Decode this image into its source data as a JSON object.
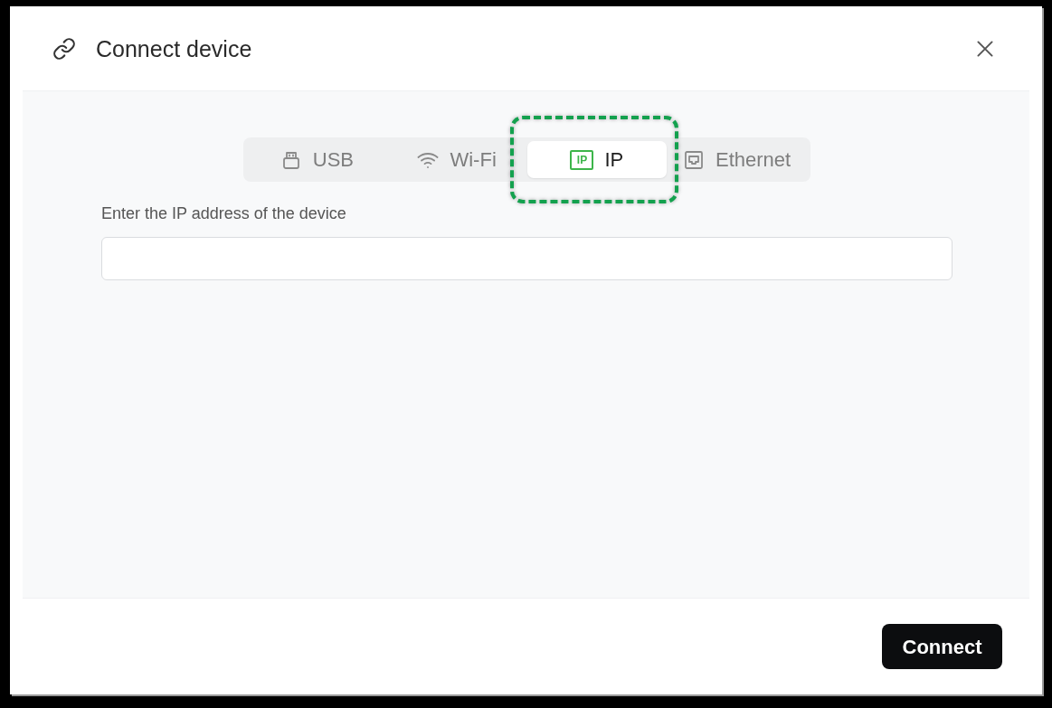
{
  "dialog": {
    "title": "Connect device"
  },
  "tabs": [
    {
      "kind": "usb",
      "label": "USB",
      "selected": false,
      "highlighted": false
    },
    {
      "kind": "wifi",
      "label": "Wi-Fi",
      "selected": false,
      "highlighted": false
    },
    {
      "kind": "ip",
      "label": "IP",
      "icon_text": "IP",
      "selected": true,
      "highlighted": true
    },
    {
      "kind": "ethernet",
      "label": "Ethernet",
      "selected": false,
      "highlighted": false
    }
  ],
  "field": {
    "label": "Enter the IP address of the device"
  },
  "buttons": [
    {
      "label": "Connect"
    }
  ]
}
